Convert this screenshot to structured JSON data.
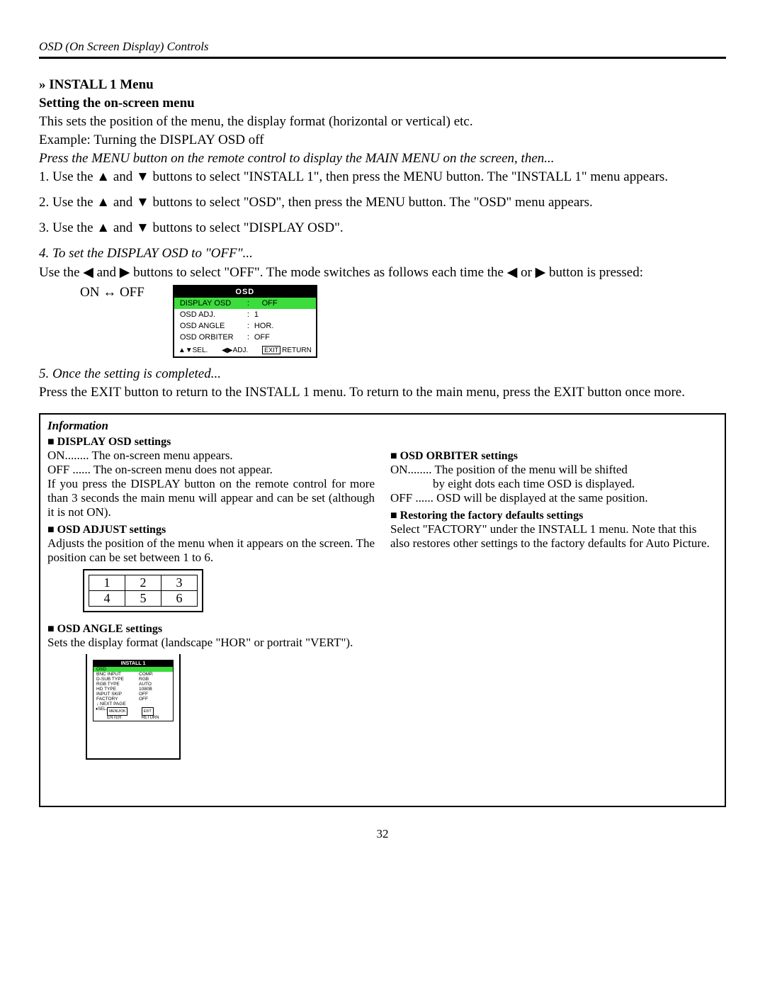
{
  "header": "OSD (On Screen Display) Controls",
  "main": {
    "h1": "» INSTALL 1 Menu",
    "h2": "Setting the on-screen menu",
    "p1": "This sets the position of the menu, the display format (horizontal or vertical) etc.",
    "p2": "Example: Turning the DISPLAY OSD off",
    "p3_italic": "Press the MENU button on the remote control to display the MAIN MENU on the screen, then...",
    "step1": "1. Use the ▲ and ▼ buttons to select \"INSTALL 1\", then press the MENU button. The \"INSTALL 1\" menu appears.",
    "step2": "2. Use the ▲ and ▼ buttons to select \"OSD\", then press the MENU button. The \"OSD\" menu appears.",
    "step3": "3. Use the ▲ and ▼ buttons to select \"DISPLAY OSD\".",
    "step4_italic": "4. To set the DISPLAY OSD to \"OFF\"...",
    "step4_body": "Use the ◀ and ▶ buttons to select \"OFF\". The mode switches as follows each time the ◀ or ▶ button is pressed:",
    "toggle": "ON ↔ OFF",
    "step5_italic": "5. Once the setting is completed...",
    "step5_body": "Press the EXIT button to return to the INSTALL 1 menu. To return to the main menu, press the EXIT button once more."
  },
  "osd_menu": {
    "title": "OSD",
    "rows": [
      {
        "label": "DISPLAY OSD",
        "value": "OFF",
        "highlighted": true,
        "arrows": true
      },
      {
        "label": "OSD ADJ.",
        "value": "1"
      },
      {
        "label": "OSD ANGLE",
        "value": "HOR."
      },
      {
        "label": "OSD ORBITER",
        "value": "OFF"
      }
    ],
    "foot_sel": "SEL.",
    "foot_adj": "ADJ.",
    "foot_exit": "EXIT",
    "foot_return": "RETURN"
  },
  "info": {
    "title": "Information",
    "display_osd_h": "■ DISPLAY OSD settings",
    "display_osd_on": "ON........ The on-screen menu appears.",
    "display_osd_off": "OFF ...... The on-screen menu does not appear.",
    "display_osd_note": "If you press the DISPLAY button on the remote control for more than 3 seconds the main menu will appear and can be set (although it is not ON).",
    "adjust_h": "■ OSD ADJUST settings",
    "adjust_body": "Adjusts the position of the menu when it appears on the screen. The position can be set between 1 to 6.",
    "pos_table": [
      [
        "1",
        "2",
        "3"
      ],
      [
        "4",
        "5",
        "6"
      ]
    ],
    "angle_h": "■ OSD ANGLE settings",
    "angle_body": "Sets the display format (landscape \"HOR\" or portrait \"VERT\").",
    "orbiter_h": "■ OSD ORBITER settings",
    "orbiter_on_a": "ON........ The position of the menu will be shifted",
    "orbiter_on_b": "by eight dots each time OSD is displayed.",
    "orbiter_off": "OFF ...... OSD will be displayed at the same position.",
    "factory_h": "■ Restoring the factory defaults settings",
    "factory_body": "Select \"FACTORY\" under the INSTALL 1 menu. Note that this also restores other settings to the factory defaults for Auto Picture."
  },
  "install_menu": {
    "title": "INSTALL 1",
    "rows": [
      {
        "l": "OSD",
        "v": "",
        "hi": true
      },
      {
        "l": "BNC INPUT",
        "v": "COMP."
      },
      {
        "l": "D-SUB TYPE",
        "v": "RGB"
      },
      {
        "l": "RGB TYPE",
        "v": "AUTO"
      },
      {
        "l": "HD TYPE",
        "v": "1080B"
      },
      {
        "l": "INPUT SKIP",
        "v": "OFF"
      },
      {
        "l": "FACTORY",
        "v": "OFF"
      },
      {
        "l": "↓   NEXT PAGE",
        "v": ""
      }
    ],
    "foot": {
      "sel": "SEL.",
      "enter_btn": "MENU/OK",
      "enter": "ENTER",
      "exit_btn": "EXIT",
      "ret": "RETURN"
    }
  },
  "page_number": "32"
}
